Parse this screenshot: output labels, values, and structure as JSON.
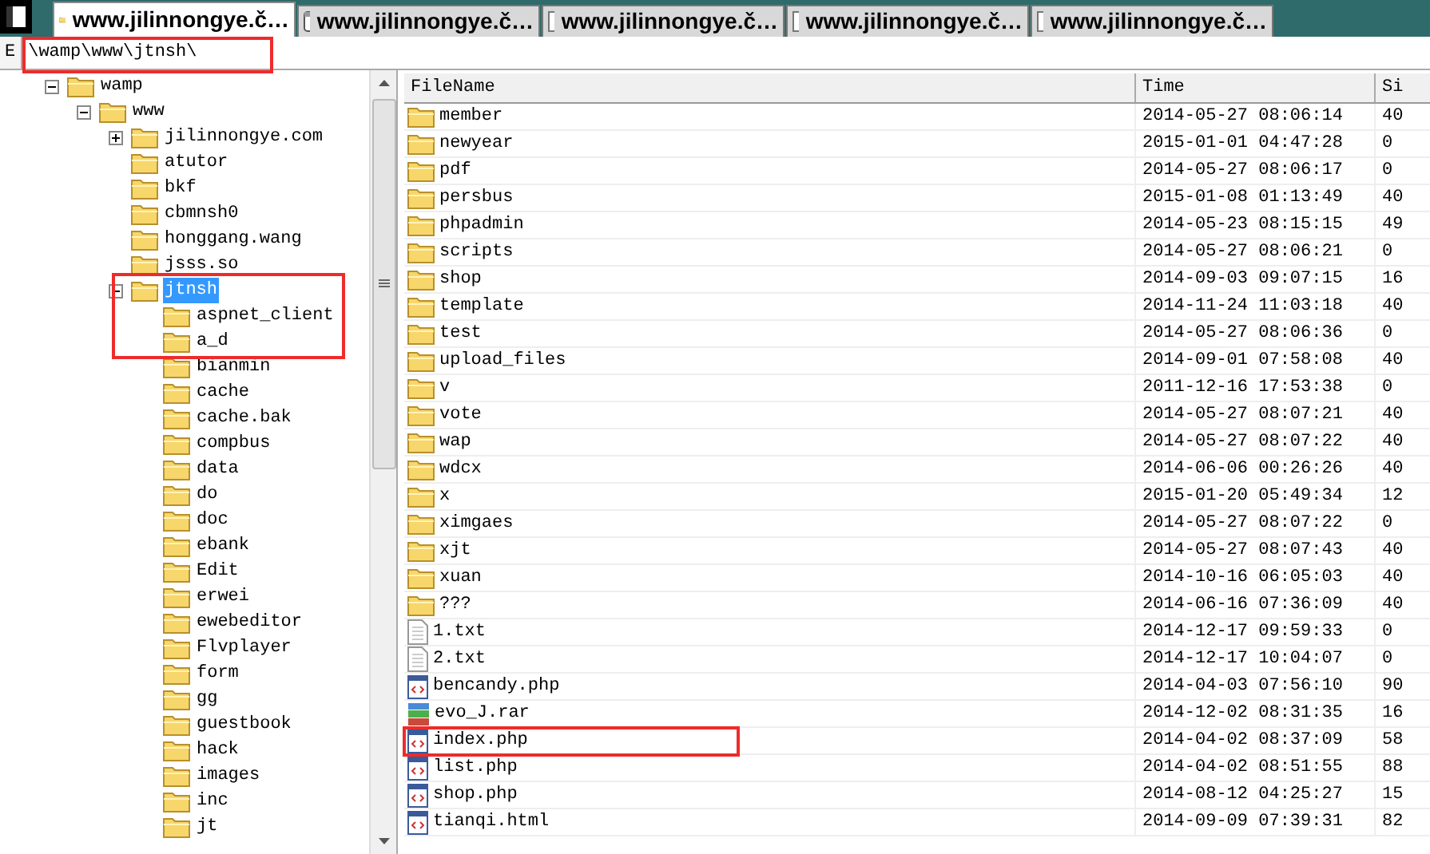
{
  "tabs": [
    {
      "label": "www.jilinnongye.č…",
      "kind": "folder",
      "selected": true
    },
    {
      "label": "www.jilinnongye.č…",
      "kind": "window",
      "selected": false
    },
    {
      "label": "www.jilinnongye.č…",
      "kind": "document",
      "selected": false
    },
    {
      "label": "www.jilinnongye.č…",
      "kind": "document",
      "selected": false
    },
    {
      "label": "www.jilinnongye.č…",
      "kind": "document",
      "selected": false
    }
  ],
  "path_bar": {
    "drive": "E",
    "path": "\\wamp\\www\\jtnsh\\"
  },
  "tree": [
    {
      "label": "wamp",
      "expanded": true,
      "selected": false,
      "children": [
        {
          "label": "www",
          "expanded": true,
          "selected": false,
          "children": [
            {
              "label": "jilinnongye.com",
              "expanded": false,
              "selected": false
            },
            {
              "label": "atutor",
              "selected": false
            },
            {
              "label": "bkf",
              "selected": false
            },
            {
              "label": "cbmnsh0",
              "selected": false
            },
            {
              "label": "honggang.wang",
              "selected": false
            },
            {
              "label": "jsss.so",
              "selected": false
            },
            {
              "label": "jtnsh",
              "expanded": true,
              "selected": true,
              "children": [
                {
                  "label": "aspnet_client",
                  "selected": false
                },
                {
                  "label": "a_d",
                  "selected": false
                },
                {
                  "label": "bianmin",
                  "selected": false
                },
                {
                  "label": "cache",
                  "selected": false
                },
                {
                  "label": "cache.bak",
                  "selected": false
                },
                {
                  "label": "compbus",
                  "selected": false
                },
                {
                  "label": "data",
                  "selected": false
                },
                {
                  "label": "do",
                  "selected": false
                },
                {
                  "label": "doc",
                  "selected": false
                },
                {
                  "label": "ebank",
                  "selected": false
                },
                {
                  "label": "Edit",
                  "selected": false
                },
                {
                  "label": "erwei",
                  "selected": false
                },
                {
                  "label": "ewebeditor",
                  "selected": false
                },
                {
                  "label": "Flvplayer",
                  "selected": false
                },
                {
                  "label": "form",
                  "selected": false
                },
                {
                  "label": "gg",
                  "selected": false
                },
                {
                  "label": "guestbook",
                  "selected": false
                },
                {
                  "label": "hack",
                  "selected": false
                },
                {
                  "label": "images",
                  "selected": false
                },
                {
                  "label": "inc",
                  "selected": false
                },
                {
                  "label": "jt",
                  "selected": false
                }
              ]
            }
          ]
        }
      ]
    }
  ],
  "table": {
    "columns": [
      "FileName",
      "Time",
      "Si"
    ],
    "rows": [
      {
        "kind": "folder",
        "name": "member",
        "time": "2014-05-27 08:06:14",
        "size": "40"
      },
      {
        "kind": "folder",
        "name": "newyear",
        "time": "2015-01-01 04:47:28",
        "size": "0"
      },
      {
        "kind": "folder",
        "name": "pdf",
        "time": "2014-05-27 08:06:17",
        "size": "0"
      },
      {
        "kind": "folder",
        "name": "persbus",
        "time": "2015-01-08 01:13:49",
        "size": "40"
      },
      {
        "kind": "folder",
        "name": "phpadmin",
        "time": "2014-05-23 08:15:15",
        "size": "49"
      },
      {
        "kind": "folder",
        "name": "scripts",
        "time": "2014-05-27 08:06:21",
        "size": "0"
      },
      {
        "kind": "folder",
        "name": "shop",
        "time": "2014-09-03 09:07:15",
        "size": "16"
      },
      {
        "kind": "folder",
        "name": "template",
        "time": "2014-11-24 11:03:18",
        "size": "40"
      },
      {
        "kind": "folder",
        "name": "test",
        "time": "2014-05-27 08:06:36",
        "size": "0"
      },
      {
        "kind": "folder",
        "name": "upload_files",
        "time": "2014-09-01 07:58:08",
        "size": "40"
      },
      {
        "kind": "folder",
        "name": "v",
        "time": "2011-12-16 17:53:38",
        "size": "0"
      },
      {
        "kind": "folder",
        "name": "vote",
        "time": "2014-05-27 08:07:21",
        "size": "40"
      },
      {
        "kind": "folder",
        "name": "wap",
        "time": "2014-05-27 08:07:22",
        "size": "40"
      },
      {
        "kind": "folder",
        "name": "wdcx",
        "time": "2014-06-06 00:26:26",
        "size": "40"
      },
      {
        "kind": "folder",
        "name": "x",
        "time": "2015-01-20 05:49:34",
        "size": "12"
      },
      {
        "kind": "folder",
        "name": "ximgaes",
        "time": "2014-05-27 08:07:22",
        "size": "0"
      },
      {
        "kind": "folder",
        "name": "xjt",
        "time": "2014-05-27 08:07:43",
        "size": "40"
      },
      {
        "kind": "folder",
        "name": "xuan",
        "time": "2014-10-16 06:05:03",
        "size": "40"
      },
      {
        "kind": "folder",
        "name": "???",
        "time": "2014-06-16 07:36:09",
        "size": "40"
      },
      {
        "kind": "text",
        "name": "1.txt",
        "time": "2014-12-17 09:59:33",
        "size": "0"
      },
      {
        "kind": "text",
        "name": "2.txt",
        "time": "2014-12-17 10:04:07",
        "size": "0"
      },
      {
        "kind": "script",
        "name": "bencandy.php",
        "time": "2014-04-03 07:56:10",
        "size": "90"
      },
      {
        "kind": "archive",
        "name": "evo_J.rar",
        "time": "2014-12-02 08:31:35",
        "size": "16"
      },
      {
        "kind": "script",
        "name": "index.php",
        "time": "2014-04-02 08:37:09",
        "size": "58"
      },
      {
        "kind": "script",
        "name": "list.php",
        "time": "2014-04-02 08:51:55",
        "size": "88"
      },
      {
        "kind": "script",
        "name": "shop.php",
        "time": "2014-08-12 04:25:27",
        "size": "15"
      },
      {
        "kind": "script",
        "name": "tianqi.html",
        "time": "2014-09-09 07:39:31",
        "size": "82"
      }
    ]
  }
}
